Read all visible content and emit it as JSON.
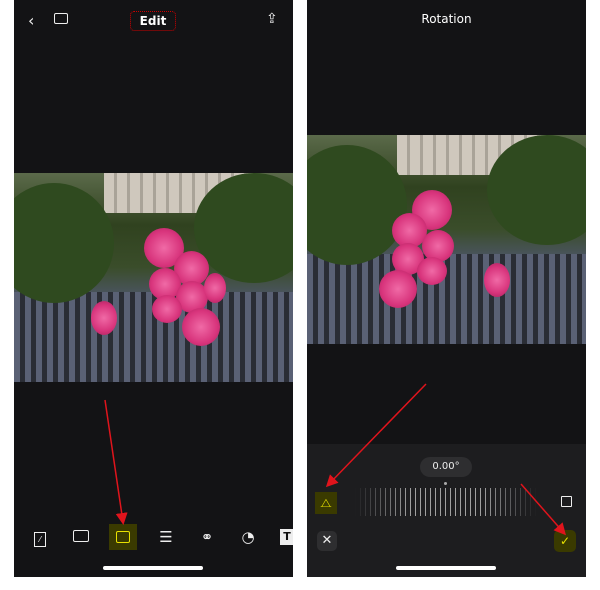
{
  "left_screen": {
    "title": "Edit",
    "icons": [
      "back-chevron-icon",
      "gallery-icon",
      "share-icon"
    ],
    "toolbar": [
      "aspect-ratio-icon",
      "layout-icon",
      "crop-rotate-icon",
      "adjust-sliders-icon",
      "filters-icon",
      "sticker-icon",
      "text-icon"
    ],
    "active_tool": "crop-rotate-icon",
    "text_tool_label": "T"
  },
  "right_screen": {
    "title": "Rotation",
    "angle": "0.00°",
    "icons": [
      "flip-icon",
      "rotate-icon",
      "cancel-icon",
      "confirm-icon"
    ]
  },
  "colors": {
    "accent": "#e8e000",
    "highlight_bg": "#3a3a00",
    "annotation": "#e0141c"
  }
}
